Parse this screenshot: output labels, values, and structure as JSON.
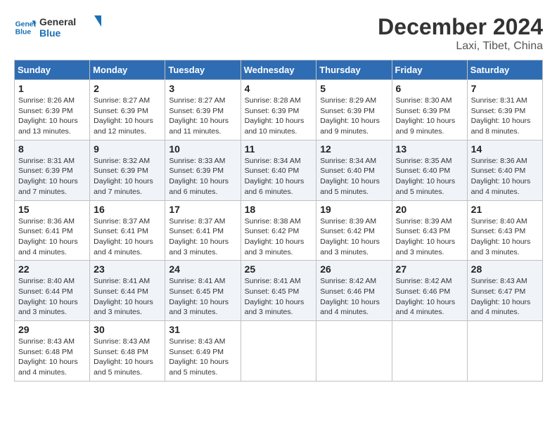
{
  "header": {
    "logo_line1": "General",
    "logo_line2": "Blue",
    "month": "December 2024",
    "location": "Laxi, Tibet, China"
  },
  "weekdays": [
    "Sunday",
    "Monday",
    "Tuesday",
    "Wednesday",
    "Thursday",
    "Friday",
    "Saturday"
  ],
  "weeks": [
    [
      {
        "day": "1",
        "sunrise": "8:26 AM",
        "sunset": "6:39 PM",
        "daylight": "10 hours and 13 minutes."
      },
      {
        "day": "2",
        "sunrise": "8:27 AM",
        "sunset": "6:39 PM",
        "daylight": "10 hours and 12 minutes."
      },
      {
        "day": "3",
        "sunrise": "8:27 AM",
        "sunset": "6:39 PM",
        "daylight": "10 hours and 11 minutes."
      },
      {
        "day": "4",
        "sunrise": "8:28 AM",
        "sunset": "6:39 PM",
        "daylight": "10 hours and 10 minutes."
      },
      {
        "day": "5",
        "sunrise": "8:29 AM",
        "sunset": "6:39 PM",
        "daylight": "10 hours and 9 minutes."
      },
      {
        "day": "6",
        "sunrise": "8:30 AM",
        "sunset": "6:39 PM",
        "daylight": "10 hours and 9 minutes."
      },
      {
        "day": "7",
        "sunrise": "8:31 AM",
        "sunset": "6:39 PM",
        "daylight": "10 hours and 8 minutes."
      }
    ],
    [
      {
        "day": "8",
        "sunrise": "8:31 AM",
        "sunset": "6:39 PM",
        "daylight": "10 hours and 7 minutes."
      },
      {
        "day": "9",
        "sunrise": "8:32 AM",
        "sunset": "6:39 PM",
        "daylight": "10 hours and 7 minutes."
      },
      {
        "day": "10",
        "sunrise": "8:33 AM",
        "sunset": "6:39 PM",
        "daylight": "10 hours and 6 minutes."
      },
      {
        "day": "11",
        "sunrise": "8:34 AM",
        "sunset": "6:40 PM",
        "daylight": "10 hours and 6 minutes."
      },
      {
        "day": "12",
        "sunrise": "8:34 AM",
        "sunset": "6:40 PM",
        "daylight": "10 hours and 5 minutes."
      },
      {
        "day": "13",
        "sunrise": "8:35 AM",
        "sunset": "6:40 PM",
        "daylight": "10 hours and 5 minutes."
      },
      {
        "day": "14",
        "sunrise": "8:36 AM",
        "sunset": "6:40 PM",
        "daylight": "10 hours and 4 minutes."
      }
    ],
    [
      {
        "day": "15",
        "sunrise": "8:36 AM",
        "sunset": "6:41 PM",
        "daylight": "10 hours and 4 minutes."
      },
      {
        "day": "16",
        "sunrise": "8:37 AM",
        "sunset": "6:41 PM",
        "daylight": "10 hours and 4 minutes."
      },
      {
        "day": "17",
        "sunrise": "8:37 AM",
        "sunset": "6:41 PM",
        "daylight": "10 hours and 3 minutes."
      },
      {
        "day": "18",
        "sunrise": "8:38 AM",
        "sunset": "6:42 PM",
        "daylight": "10 hours and 3 minutes."
      },
      {
        "day": "19",
        "sunrise": "8:39 AM",
        "sunset": "6:42 PM",
        "daylight": "10 hours and 3 minutes."
      },
      {
        "day": "20",
        "sunrise": "8:39 AM",
        "sunset": "6:43 PM",
        "daylight": "10 hours and 3 minutes."
      },
      {
        "day": "21",
        "sunrise": "8:40 AM",
        "sunset": "6:43 PM",
        "daylight": "10 hours and 3 minutes."
      }
    ],
    [
      {
        "day": "22",
        "sunrise": "8:40 AM",
        "sunset": "6:44 PM",
        "daylight": "10 hours and 3 minutes."
      },
      {
        "day": "23",
        "sunrise": "8:41 AM",
        "sunset": "6:44 PM",
        "daylight": "10 hours and 3 minutes."
      },
      {
        "day": "24",
        "sunrise": "8:41 AM",
        "sunset": "6:45 PM",
        "daylight": "10 hours and 3 minutes."
      },
      {
        "day": "25",
        "sunrise": "8:41 AM",
        "sunset": "6:45 PM",
        "daylight": "10 hours and 3 minutes."
      },
      {
        "day": "26",
        "sunrise": "8:42 AM",
        "sunset": "6:46 PM",
        "daylight": "10 hours and 4 minutes."
      },
      {
        "day": "27",
        "sunrise": "8:42 AM",
        "sunset": "6:46 PM",
        "daylight": "10 hours and 4 minutes."
      },
      {
        "day": "28",
        "sunrise": "8:43 AM",
        "sunset": "6:47 PM",
        "daylight": "10 hours and 4 minutes."
      }
    ],
    [
      {
        "day": "29",
        "sunrise": "8:43 AM",
        "sunset": "6:48 PM",
        "daylight": "10 hours and 4 minutes."
      },
      {
        "day": "30",
        "sunrise": "8:43 AM",
        "sunset": "6:48 PM",
        "daylight": "10 hours and 5 minutes."
      },
      {
        "day": "31",
        "sunrise": "8:43 AM",
        "sunset": "6:49 PM",
        "daylight": "10 hours and 5 minutes."
      },
      null,
      null,
      null,
      null
    ]
  ]
}
